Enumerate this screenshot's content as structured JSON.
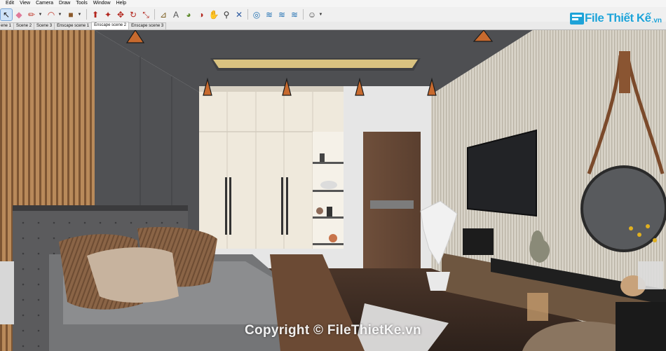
{
  "menu": [
    "Edit",
    "View",
    "Camera",
    "Draw",
    "Tools",
    "Window",
    "Help"
  ],
  "toolbar": [
    {
      "icon": "select-arrow-icon",
      "glyph": "↖",
      "color": "#1d1d1d",
      "active": true
    },
    {
      "icon": "eraser-icon",
      "glyph": "◆",
      "color": "#e07a9a"
    },
    {
      "icon": "pencil-line-icon",
      "glyph": "✏",
      "color": "#c0392b",
      "dropdown": true
    },
    {
      "icon": "arc-icon",
      "glyph": "◠",
      "color": "#c0392b",
      "dropdown": true
    },
    {
      "icon": "rectangle-shape-icon",
      "glyph": "■",
      "color": "#8b5a2b",
      "dropdown": true
    },
    {
      "icon": "push-pull-icon",
      "glyph": "⬆",
      "color": "#b3261e"
    },
    {
      "icon": "follow-me-icon",
      "glyph": "✦",
      "color": "#b3261e"
    },
    {
      "icon": "move-icon",
      "glyph": "✥",
      "color": "#b3261e"
    },
    {
      "icon": "rotate-icon",
      "glyph": "↻",
      "color": "#b3261e"
    },
    {
      "icon": "scale-icon",
      "glyph": "⤡",
      "color": "#b3261e"
    },
    {
      "icon": "tape-measure-icon",
      "glyph": "⊿",
      "color": "#7a5c1e"
    },
    {
      "icon": "text-icon",
      "glyph": "A",
      "color": "#555555"
    },
    {
      "icon": "paint-bucket-icon",
      "glyph": "◕",
      "color": "#5d8a2b"
    },
    {
      "icon": "orbit-icon",
      "glyph": "◑",
      "color": "#b3261e"
    },
    {
      "icon": "pan-hand-icon",
      "glyph": "✋",
      "color": "#c58a3a"
    },
    {
      "icon": "zoom-icon",
      "glyph": "⚲",
      "color": "#333333"
    },
    {
      "icon": "zoom-extents-icon",
      "glyph": "✕",
      "color": "#2c5aa0"
    },
    {
      "icon": "enscape-start-icon",
      "glyph": "◎",
      "color": "#1f6fb2"
    },
    {
      "icon": "enscape-sync-icon",
      "glyph": "≋",
      "color": "#1f6fb2"
    },
    {
      "icon": "enscape-views-icon",
      "glyph": "≋",
      "color": "#1f6fb2"
    },
    {
      "icon": "enscape-settings-icon",
      "glyph": "≋",
      "color": "#1f6fb2"
    },
    {
      "icon": "user-account-icon",
      "glyph": "☺",
      "color": "#444444",
      "dropdown": true
    }
  ],
  "tabs": [
    "ene 1",
    "Scene 2",
    "Scene 3",
    "Enscape scene 1",
    "Enscape scene 2",
    "Enscape scene 3"
  ],
  "active_tab": 4,
  "logo": {
    "text": "File Thiết Kế",
    "suffix": ".vn"
  },
  "watermark": "Copyright © FileThietKe.vn",
  "colors": {
    "accent": "#1ea3d8",
    "ceiling": "#4e4f52",
    "floor": "#3a2a22",
    "wardrobe": "#efe9dc"
  }
}
